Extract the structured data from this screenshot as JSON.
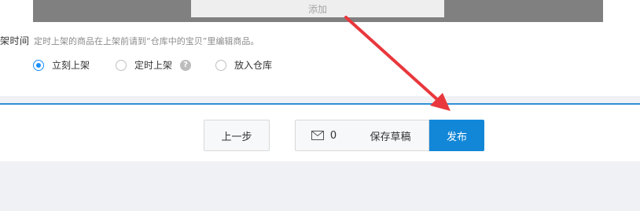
{
  "upload": {
    "add_label": "添加"
  },
  "listing": {
    "label": "架时间",
    "hint": "定时上架的商品在上架前请到“仓库中的宝贝”里编辑商品。",
    "options": [
      {
        "label": "立刻上架",
        "selected": true
      },
      {
        "label": "定时上架",
        "selected": false
      },
      {
        "label": "放入仓库",
        "selected": false
      }
    ],
    "help_glyph": "?"
  },
  "actions": {
    "prev_label": "上一步",
    "message_count": "0",
    "save_draft_label": "保存草稿",
    "publish_label": "发布"
  },
  "colors": {
    "accent": "#1287d7",
    "radio_selected": "#1890ff",
    "annotation_arrow": "#e8383d"
  }
}
